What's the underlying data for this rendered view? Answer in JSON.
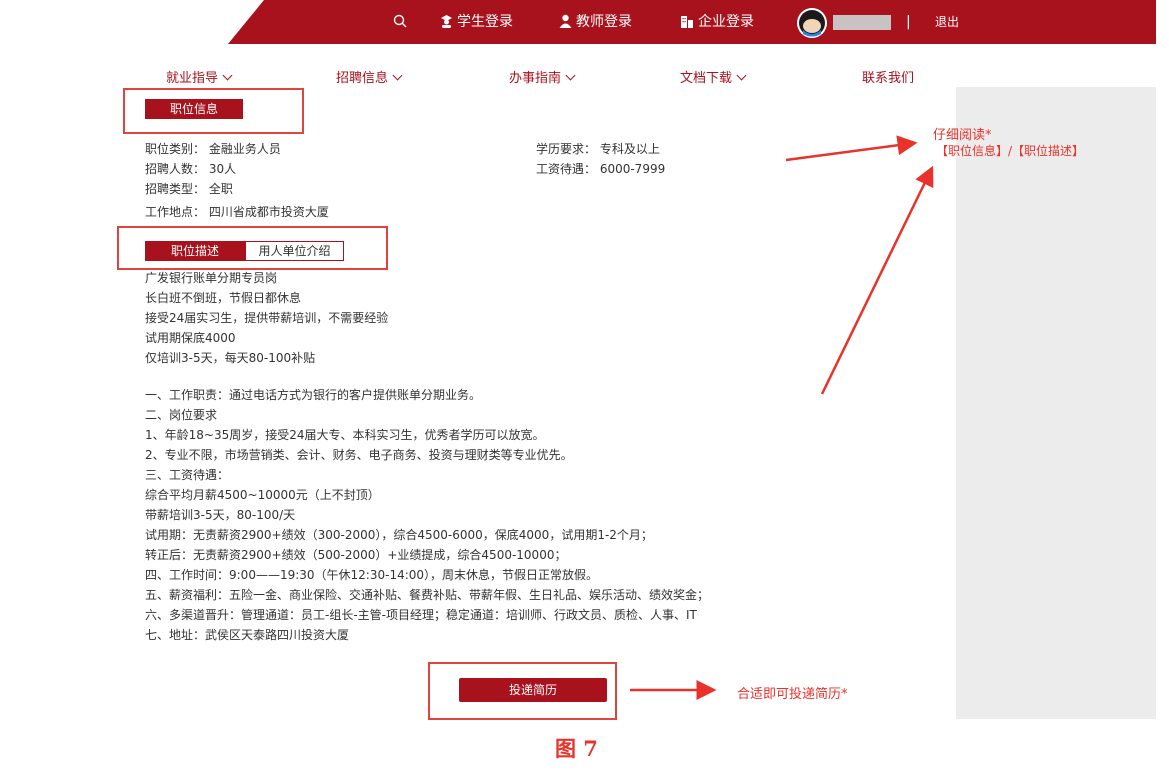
{
  "header": {
    "student_login": "学生登录",
    "teacher_login": "教师登录",
    "company_login": "企业登录",
    "divider": "|",
    "logout": "退出"
  },
  "nav": {
    "items": [
      "就业指导",
      "招聘信息",
      "办事指南",
      "文档下载",
      "联系我们"
    ]
  },
  "job_info": {
    "tab_label": "职位信息",
    "category": "职位类别： 金融业务人员",
    "education": "学历要求： 专科及以上",
    "headcount": "招聘人数： 30人",
    "salary": "工资待遇： 6000-7999",
    "type": "招聘类型： 全职",
    "location": "工作地点： 四川省成都市投资大厦"
  },
  "tabs": {
    "description": "职位描述",
    "employer_intro": "用人单位介绍"
  },
  "description": {
    "lines": [
      "广发银行账单分期专员岗",
      "长白班不倒班，节假日都休息",
      "接受24届实习生，提供带薪培训，不需要经验",
      "试用期保底4000",
      "仅培训3-5天，每天80-100补贴",
      "",
      "一、工作职责：通过电话方式为银行的客户提供账单分期业务。",
      "二、岗位要求",
      "1、年龄18~35周岁，接受24届大专、本科实习生，优秀者学历可以放宽。",
      "2、专业不限，市场营销类、会计、财务、电子商务、投资与理财类等专业优先。",
      "三、工资待遇：",
      "综合平均月薪4500~10000元（上不封顶）",
      "带薪培训3-5天，80-100/天",
      "试用期：无责薪资2900+绩效（300-2000），综合4500-6000，保底4000，试用期1-2个月；",
      "转正后：无责薪资2900+绩效（500-2000）+业绩提成，综合4500-10000；",
      "四、工作时间：9:00——19:30（午休12:30-14:00），周末休息，节假日正常放假。",
      "五、薪资福利：五险一金、商业保险、交通补贴、餐费补贴、带薪年假、生日礼品、娱乐活动、绩效奖金；",
      "六、多渠道晋升：管理通道：员工-组长-主管-项目经理；稳定通道：培训师、行政文员、质检、人事、IT",
      "七、地址：武侯区天泰路四川投资大厦"
    ]
  },
  "apply_button": "投递简历",
  "annotations": {
    "read_carefully": "仔细阅读*",
    "read_targets": "【职位信息】/【职位描述】",
    "apply_hint": "合适即可投递简历*"
  },
  "figure_caption": "图 7"
}
